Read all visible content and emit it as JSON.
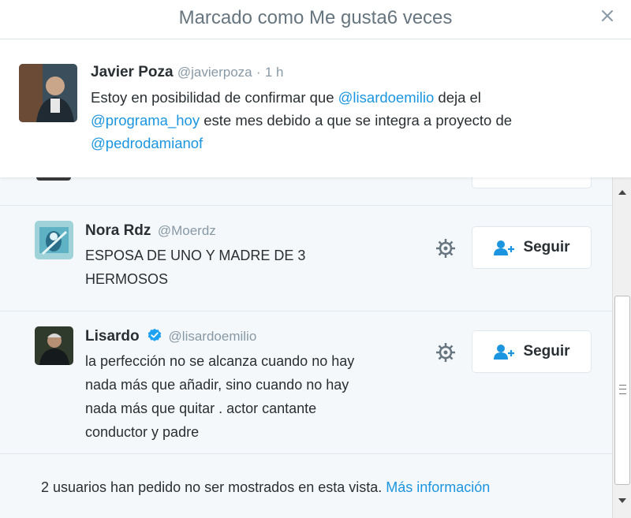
{
  "modal": {
    "title": "Marcado como Me gusta6 veces",
    "close_icon": "close-icon"
  },
  "tweet": {
    "name": "Javier Poza",
    "handle": "@javierpoza",
    "separator": "·",
    "time": "1 h",
    "text_parts": [
      "Estoy en posibilidad de confirmar que ",
      "@lisardoemilio",
      " deja el ",
      "@programa_hoy",
      " este mes debido a que se integra a proyecto de ",
      "@pedrodamianof"
    ]
  },
  "users": [
    {
      "name": "Nora Rdz",
      "handle": "@Moerdz",
      "bio": "ESPOSA DE UNO Y MADRE DE 3 HERMOSOS",
      "verified": false,
      "follow_label": "Seguir"
    },
    {
      "name": "Lisardo",
      "handle": "@lisardoemilio",
      "bio": "la perfección no se alcanza cuando no hay nada más que añadir, sino cuando no hay nada más que quitar . actor cantante conductor y padre",
      "verified": true,
      "follow_label": "Seguir"
    }
  ],
  "footer": {
    "note": "2 usuarios han pedido no ser mostrados en esta vista. ",
    "link": "Más información"
  },
  "colors": {
    "link": "#1b95e0",
    "verified": "#1da1f2",
    "muted": "#8899a6",
    "follow_icon": "#1b95e0"
  }
}
